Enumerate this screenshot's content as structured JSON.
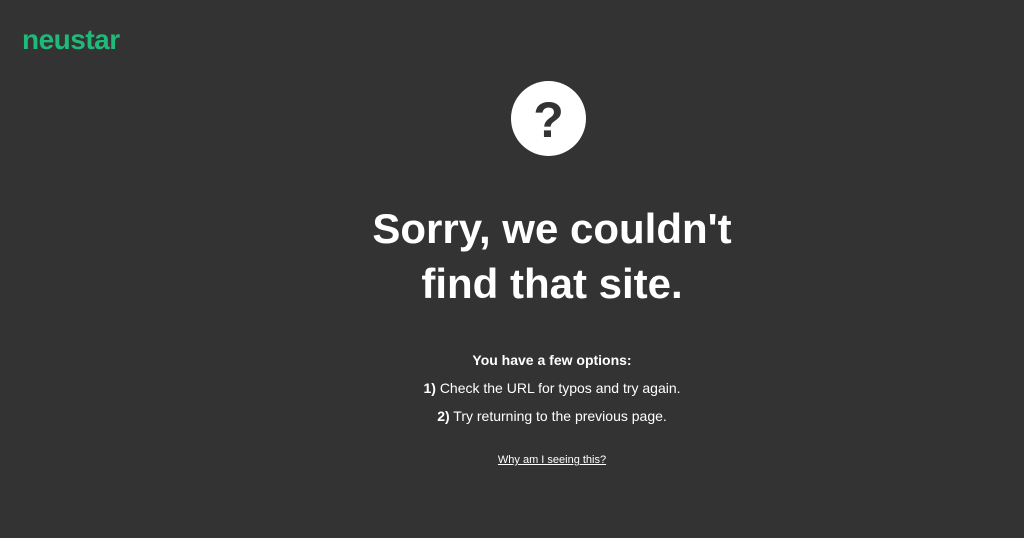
{
  "brand": {
    "logo_text": "neustar",
    "logo_color": "#1fb97a"
  },
  "error": {
    "icon": "question-mark-icon",
    "icon_glyph": "?",
    "headline_line1": "Sorry, we couldn't",
    "headline_line2": "find that site."
  },
  "options": {
    "intro": "You have a few options:",
    "items": [
      {
        "number": "1)",
        "text": "Check the URL for typos and try again."
      },
      {
        "number": "2)",
        "text": "Try returning to the previous page."
      }
    ]
  },
  "help_link": {
    "label": "Why am I seeing this?"
  },
  "colors": {
    "background": "#333333",
    "text": "#ffffff"
  }
}
